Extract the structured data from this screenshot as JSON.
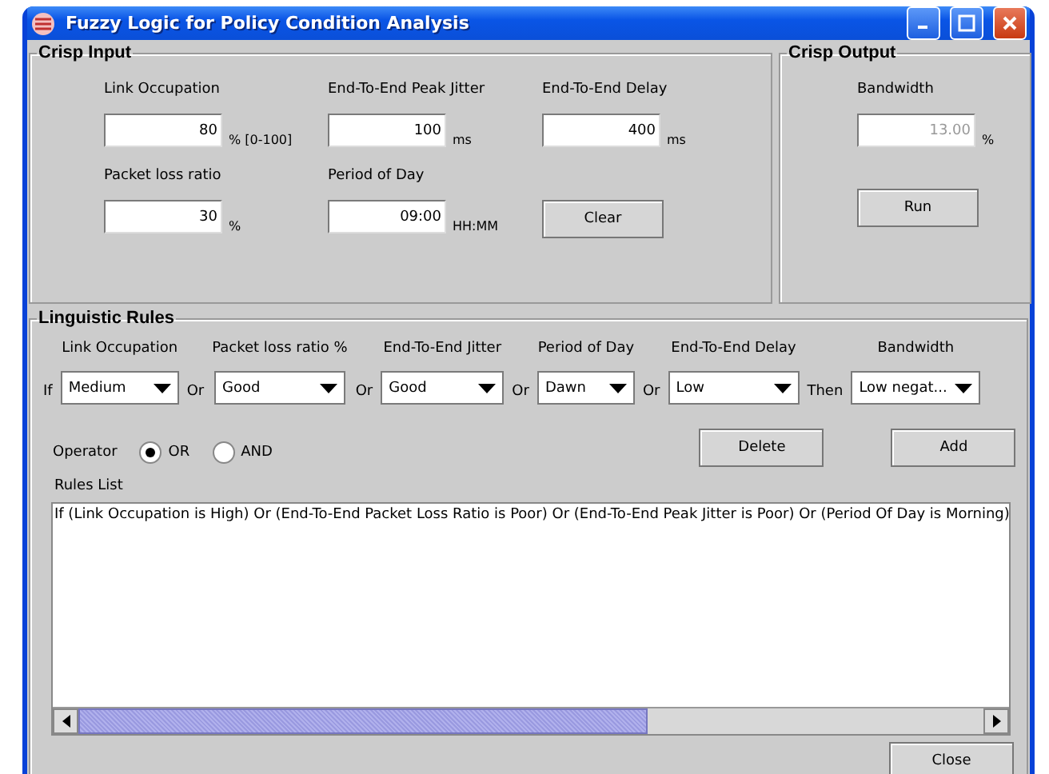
{
  "window": {
    "title": "Fuzzy Logic for Policy Condition Analysis"
  },
  "crisp_input": {
    "title": "Crisp Input",
    "fields": [
      {
        "label": "Link Occupation",
        "value": "80",
        "unit": "% [0-100]"
      },
      {
        "label": "End-To-End Peak Jitter",
        "value": "100",
        "unit": "ms"
      },
      {
        "label": "End-To-End Delay",
        "value": "400",
        "unit": "ms"
      },
      {
        "label": "Packet loss ratio",
        "value": "30",
        "unit": "%"
      },
      {
        "label": "Period of Day",
        "value": "09:00",
        "unit": "HH:MM"
      }
    ],
    "clear_button": "Clear"
  },
  "crisp_output": {
    "title": "Crisp Output",
    "field": {
      "label": "Bandwidth",
      "value": "13.00",
      "unit": "%",
      "disabled": true
    },
    "run_button": "Run"
  },
  "linguistic_rules": {
    "title": "Linguistic Rules",
    "conditions": [
      {
        "connector": "If",
        "label": "Link Occupation",
        "value": "Medium"
      },
      {
        "connector": "Or",
        "label": "Packet loss ratio %",
        "value": "Good"
      },
      {
        "connector": "Or",
        "label": "End-To-End Jitter",
        "value": "Good"
      },
      {
        "connector": "Or",
        "label": "Period of Day",
        "value": "Dawn"
      },
      {
        "connector": "Or",
        "label": "End-To-End Delay",
        "value": "Low"
      },
      {
        "connector": "Then",
        "label": "Bandwidth",
        "value": "Low negat..."
      }
    ],
    "operator": {
      "label": "Operator",
      "options": [
        {
          "label": "OR",
          "selected": true
        },
        {
          "label": "AND",
          "selected": false
        }
      ]
    },
    "buttons": [
      "Delete",
      "Add"
    ],
    "rules_list": {
      "label": "Rules List",
      "items": [
        "If (Link Occupation is High) Or (End-To-End Packet Loss Ratio is Poor) Or (End-To-End Peak Jitter is Poor) Or (Period Of Day is Morning)"
      ]
    }
  },
  "close_button": "Close"
}
